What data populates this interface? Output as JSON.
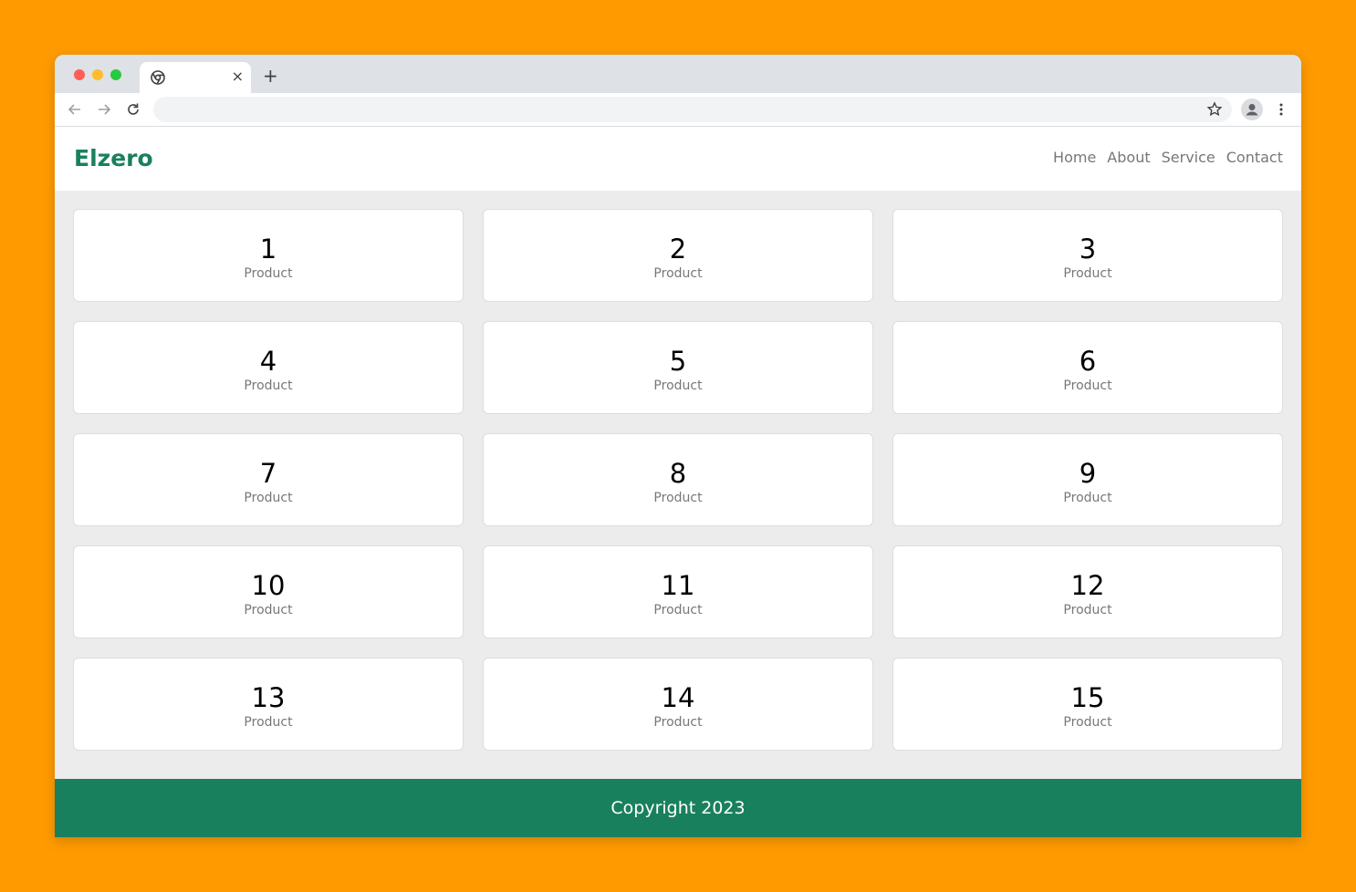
{
  "browser": {
    "tab": {
      "title": "",
      "close": "×"
    },
    "new_tab": "+",
    "url": ""
  },
  "header": {
    "logo": "Elzero",
    "nav": [
      "Home",
      "About",
      "Service",
      "Contact"
    ]
  },
  "products": [
    {
      "number": "1",
      "label": "Product"
    },
    {
      "number": "2",
      "label": "Product"
    },
    {
      "number": "3",
      "label": "Product"
    },
    {
      "number": "4",
      "label": "Product"
    },
    {
      "number": "5",
      "label": "Product"
    },
    {
      "number": "6",
      "label": "Product"
    },
    {
      "number": "7",
      "label": "Product"
    },
    {
      "number": "8",
      "label": "Product"
    },
    {
      "number": "9",
      "label": "Product"
    },
    {
      "number": "10",
      "label": "Product"
    },
    {
      "number": "11",
      "label": "Product"
    },
    {
      "number": "12",
      "label": "Product"
    },
    {
      "number": "13",
      "label": "Product"
    },
    {
      "number": "14",
      "label": "Product"
    },
    {
      "number": "15",
      "label": "Product"
    }
  ],
  "footer": {
    "text": "Copyright 2023"
  },
  "colors": {
    "accent": "#19805d",
    "page_bg": "#ff9b00",
    "content_bg": "#ececec"
  },
  "icons": [
    "chrome-icon",
    "back-arrow-icon",
    "forward-arrow-icon",
    "reload-icon",
    "star-icon",
    "profile-icon",
    "kebab-menu-icon"
  ]
}
